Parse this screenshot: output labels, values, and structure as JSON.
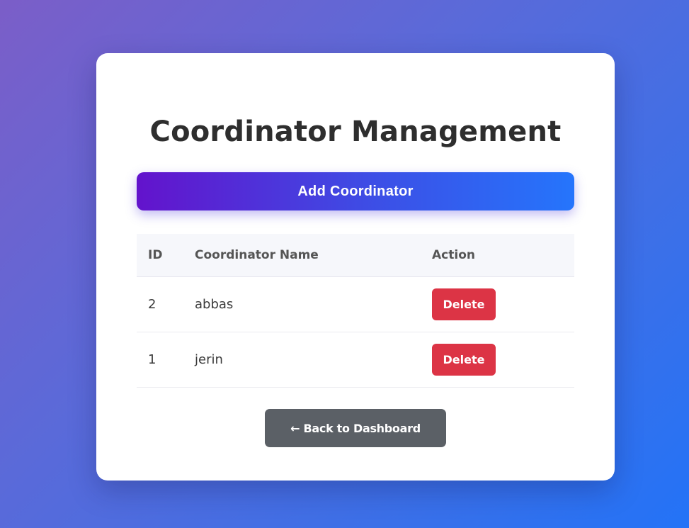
{
  "page": {
    "title": "Coordinator Management"
  },
  "actions": {
    "add_label": "Add Coordinator",
    "back_label": "← Back to Dashboard"
  },
  "table": {
    "headers": {
      "id": "ID",
      "name": "Coordinator Name",
      "action": "Action"
    },
    "rows": [
      {
        "id": "2",
        "name": "abbas",
        "action_label": "Delete"
      },
      {
        "id": "1",
        "name": "jerin",
        "action_label": "Delete"
      }
    ]
  },
  "colors": {
    "add_gradient_start": "#6313cc",
    "add_gradient_end": "#2575fc",
    "delete": "#dc3445",
    "back": "#5b6066"
  }
}
